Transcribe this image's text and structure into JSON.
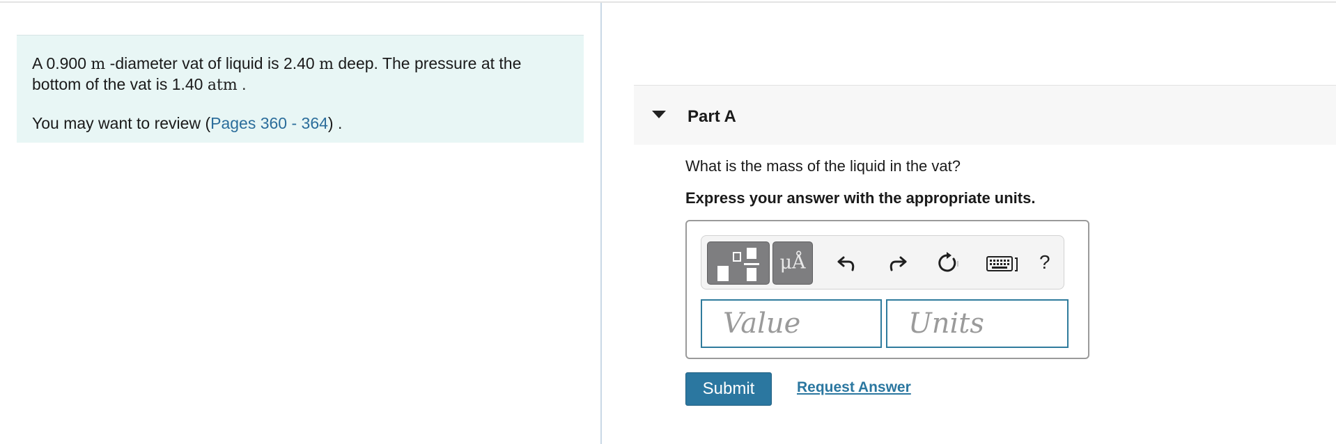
{
  "problem": {
    "line1_a": "A 0.900 ",
    "unit_m1": "m",
    "line1_b": " -diameter vat of liquid is 2.40 ",
    "unit_m2": "m",
    "line1_c": " deep. The pressure at the bottom of the vat is 1.40 ",
    "unit_atm": "atm",
    "line1_d": " .",
    "review_prefix": "You may want to review (",
    "review_link": "Pages 360 - 364",
    "review_suffix": ") ."
  },
  "part": {
    "title": "Part A",
    "question": "What is the mass of the liquid in the vat?",
    "instruction": "Express your answer with the appropriate units."
  },
  "toolbar": {
    "units_label": "μÅ",
    "help_label": "?"
  },
  "inputs": {
    "value_placeholder": "Value",
    "units_placeholder": "Units"
  },
  "actions": {
    "submit_label": "Submit",
    "request_label": "Request Answer"
  },
  "colors": {
    "panel_bg": "#e8f6f5",
    "link": "#2b6d9b",
    "accent": "#2b77a0",
    "toolbar_button": "#7e7e80"
  }
}
